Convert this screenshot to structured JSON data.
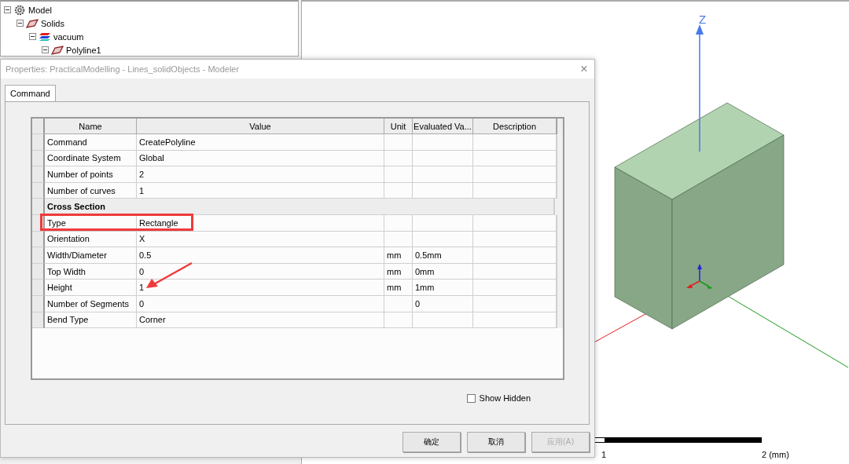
{
  "tree": [
    {
      "label": "Model",
      "kind": "model",
      "expanded": true,
      "children": [
        {
          "label": "Solids",
          "kind": "solid",
          "expanded": true,
          "children": [
            {
              "label": "vacuum",
              "kind": "material",
              "expanded": true,
              "children": [
                {
                  "label": "Polyline1",
                  "kind": "solid",
                  "expanded": true
                }
              ]
            }
          ]
        }
      ]
    }
  ],
  "viewport": {
    "axis_label": "Z",
    "scale_labels": [
      "1",
      "2 (mm)"
    ]
  },
  "dialog": {
    "title": "Properties: PracticalModelling - Lines_solidObjects - Modeler",
    "close": "×",
    "tabs": [
      {
        "label": "Command",
        "selected": true
      }
    ],
    "columns": [
      "Name",
      "Value",
      "Unit",
      "Evaluated Va...",
      "Description"
    ],
    "rows": [
      {
        "kind": "property",
        "cells": [
          "Command",
          "CreatePolyline",
          "",
          "",
          ""
        ],
        "highlighted": false,
        "pointed": false
      },
      {
        "kind": "property",
        "cells": [
          "Coordinate System",
          "Global",
          "",
          "",
          ""
        ],
        "highlighted": false,
        "pointed": false
      },
      {
        "kind": "property",
        "cells": [
          "Number of points",
          "2",
          "",
          "",
          ""
        ],
        "highlighted": false,
        "pointed": false
      },
      {
        "kind": "property",
        "cells": [
          "Number of curves",
          "1",
          "",
          "",
          ""
        ],
        "highlighted": false,
        "pointed": false
      },
      {
        "kind": "section",
        "cells": [
          "Cross Section"
        ]
      },
      {
        "kind": "property",
        "cells": [
          "Type",
          "Rectangle",
          "",
          "",
          ""
        ],
        "highlighted": true,
        "pointed": false
      },
      {
        "kind": "property",
        "cells": [
          "Orientation",
          "X",
          "",
          "",
          ""
        ],
        "highlighted": false,
        "pointed": false
      },
      {
        "kind": "property",
        "cells": [
          "Width/Diameter",
          "0.5",
          "mm",
          "0.5mm",
          ""
        ],
        "highlighted": false,
        "pointed": false
      },
      {
        "kind": "property",
        "cells": [
          "Top Width",
          "0",
          "mm",
          "0mm",
          ""
        ],
        "highlighted": false,
        "pointed": false
      },
      {
        "kind": "property",
        "cells": [
          "Height",
          "1",
          "mm",
          "1mm",
          ""
        ],
        "highlighted": false,
        "pointed": true
      },
      {
        "kind": "property",
        "cells": [
          "Number of Segments",
          "0",
          "",
          "0",
          ""
        ],
        "highlighted": false,
        "pointed": false
      },
      {
        "kind": "property",
        "cells": [
          "Bend Type",
          "Corner",
          "",
          "",
          ""
        ],
        "highlighted": false,
        "pointed": false
      }
    ],
    "show_hidden": {
      "label": "Show Hidden",
      "checked": false
    },
    "buttons": [
      {
        "label": "确定",
        "disabled": false
      },
      {
        "label": "取消",
        "disabled": false
      },
      {
        "label": "应用(A)",
        "disabled": true
      }
    ]
  }
}
